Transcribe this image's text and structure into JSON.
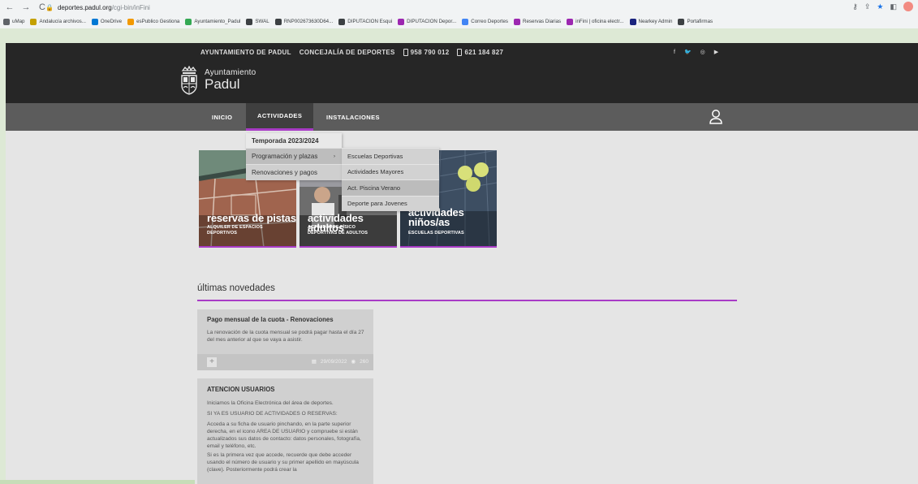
{
  "browser": {
    "url_host": "deportes.padul.org",
    "url_path": "/cgi-bin/inFini",
    "bookmarks": [
      {
        "label": "uMap",
        "color": "#5f6368"
      },
      {
        "label": "Andalucía archivos...",
        "color": "#c4a000"
      },
      {
        "label": "OneDrive",
        "color": "#0078d4"
      },
      {
        "label": "esPublico Gestiona",
        "color": "#f29900"
      },
      {
        "label": "Ayuntamiento_Padul",
        "color": "#34a853"
      },
      {
        "label": "SWAL",
        "color": "#3c4043"
      },
      {
        "label": "RNP002673630D64...",
        "color": "#3c4043"
      },
      {
        "label": "DIPUTACION Esqui",
        "color": "#3c4043"
      },
      {
        "label": "DIPUTACION Depor...",
        "color": "#9c27b0"
      },
      {
        "label": "Correo Deportes",
        "color": "#4285f4"
      },
      {
        "label": "Reservas Diarias",
        "color": "#9c27b0"
      },
      {
        "label": "inFini | oficina electr...",
        "color": "#9c27b0"
      },
      {
        "label": "Nearkey Admin",
        "color": "#1a237e"
      },
      {
        "label": "Portafirmas",
        "color": "#3c4043"
      }
    ]
  },
  "topbar": {
    "org": "AYUNTAMIENTO DE PADUL",
    "dept": "CONCEJALÍA DE DEPORTES",
    "phone1": "958 790 012",
    "phone2": "621 184 827"
  },
  "logo": {
    "line1": "Ayuntamiento",
    "line2": "Padul"
  },
  "nav": {
    "inicio": "INICIO",
    "actividades": "ACTIVIDADES",
    "instalaciones": "INSTALACIONES"
  },
  "dropdown": {
    "header": "Temporada 2023/2024",
    "items": [
      "Programación y plazas",
      "Renovaciones y pagos"
    ],
    "arrow": "›",
    "submenu": [
      "Escuelas Deportivas",
      "Actividades Mayores",
      "Act. Piscina Verano",
      "Deporte para Jovenes"
    ]
  },
  "tiles": [
    {
      "title": "reservas de pistas",
      "sub1": "ALQUILER DE ESPACIOS",
      "sub2": "DEPORTIVOS"
    },
    {
      "title": "actividades adultos",
      "sub1": "ACTIVIDADES FÍSICO",
      "sub2": "DEPORTIVAS DE ADULTOS"
    },
    {
      "title1": "actividades",
      "title2": "niños/as",
      "sub1": "ESCUELAS DEPORTIVAS"
    }
  ],
  "novedades": {
    "title": "últimas novedades",
    "cards": [
      {
        "heading": "Pago mensual de la cuota - Renovaciones",
        "body": "La renovación de la cuota mensual se podrá pagar hasta el día 27 del mes anterior al que se vaya a asistir.",
        "date": "29/09/2022",
        "views": "260"
      },
      {
        "heading": "ATENCION USUARIOS",
        "p1": "Iniciamos la Oficina Electrónica del área de deportes.",
        "p2": "SI YA ES USUARIO DE ACTIVIDADES O RESERVAS:",
        "p3": "Acceda a su ficha de usuario pinchando, en la parte superior derecha, en el icono AREA DE USUARIO y compruebe si están actualizados sus datos de contacto: datos personales, fotografía, email y teléfono, etc.",
        "p4": "Si es la primera vez que accede, recuerde que debe acceder usando el número de usuario y su primer apellido en mayúscula (clave). Posteriormente podrá crear la"
      }
    ]
  },
  "colors": {
    "accent": "#a83bc6",
    "dark": "#262626",
    "nav": "#5c5c5c"
  }
}
